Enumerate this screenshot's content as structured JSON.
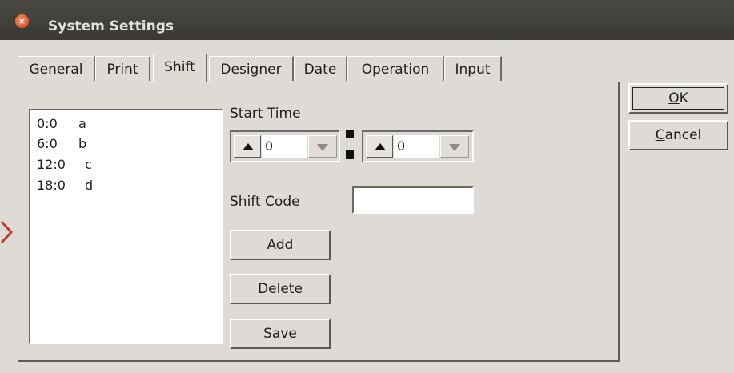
{
  "window": {
    "title": "System Settings",
    "close_glyph": "×"
  },
  "tabs": [
    {
      "label": "General"
    },
    {
      "label": "Print"
    },
    {
      "label": "Shift"
    },
    {
      "label": "Designer"
    },
    {
      "label": "Date"
    },
    {
      "label": "Operation"
    },
    {
      "label": "Input"
    }
  ],
  "active_tab": "Shift",
  "shift_list": [
    {
      "time": "0:0",
      "code": "a"
    },
    {
      "time": "6:0",
      "code": "b"
    },
    {
      "time": "12:0",
      "code": "c"
    },
    {
      "time": "18:0",
      "code": "d"
    }
  ],
  "start_time": {
    "label": "Start Time",
    "hour": "0",
    "minute": "0"
  },
  "shift_code": {
    "label": "Shift Code",
    "value": ""
  },
  "buttons": {
    "add": "Add",
    "delete": "Delete",
    "save": "Save"
  },
  "dialog": {
    "ok_mnemonic": "O",
    "ok_rest": "K",
    "cancel_mnemonic": "C",
    "cancel_rest": "ancel"
  },
  "colors": {
    "titlebar": "#3f3e3a",
    "background": "#dedad5",
    "close_button": "#e8541e",
    "accent_arrow": "#c0392b"
  }
}
